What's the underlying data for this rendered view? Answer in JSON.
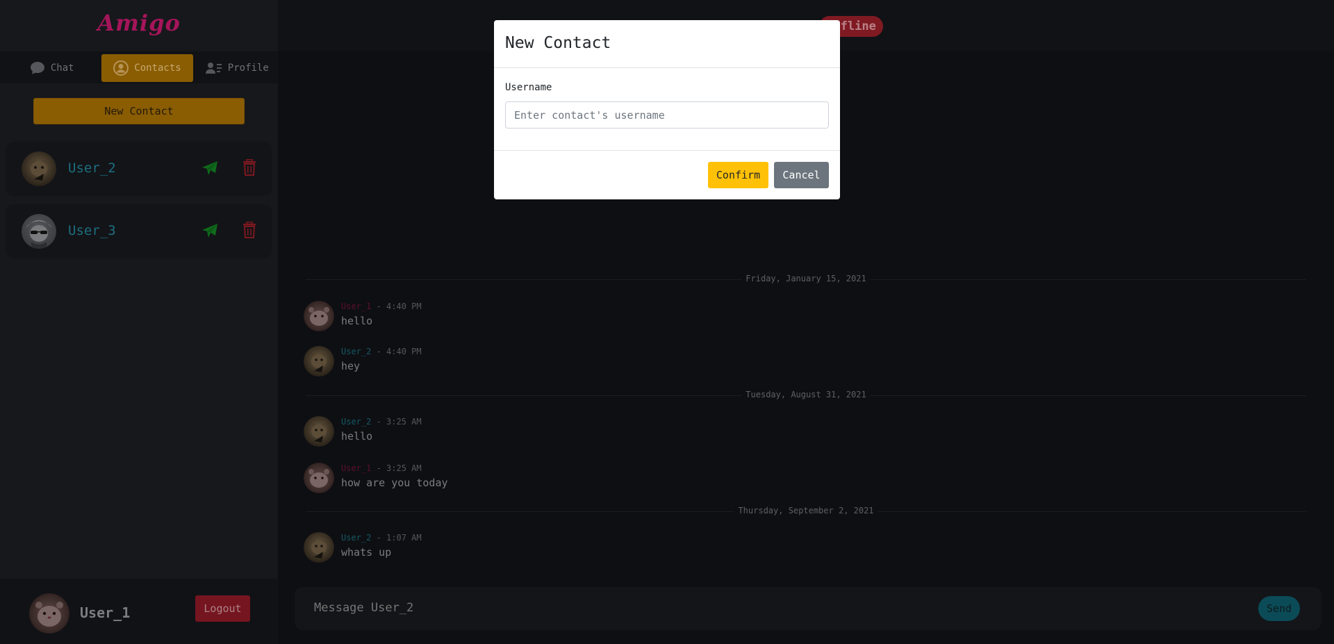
{
  "app": {
    "logo": "Amigo"
  },
  "nav": {
    "chat": "Chat",
    "contacts": "Contacts",
    "profile": "Profile"
  },
  "sidebar": {
    "new_contact_label": "New Contact",
    "contacts": [
      {
        "name": "User_2"
      },
      {
        "name": "User_3"
      }
    ]
  },
  "current_user": {
    "name": "User_1",
    "logout_label": "Logout"
  },
  "chat": {
    "status": "Offline",
    "date_separators": [
      "Friday, January 15, 2021",
      "Tuesday, August 31, 2021",
      "Thursday, September 2, 2021"
    ],
    "messages": [
      {
        "user": "User_1",
        "time": " - 4:40 PM",
        "text": "hello"
      },
      {
        "user": "User_2",
        "time": " - 4:40 PM",
        "text": "hey"
      },
      {
        "user": "User_2",
        "time": " - 3:25 AM",
        "text": "hello"
      },
      {
        "user": "User_1",
        "time": " - 3:25 AM",
        "text": "how are you today"
      },
      {
        "user": "User_2",
        "time": " - 1:07 AM",
        "text": "whats up"
      }
    ],
    "compose_placeholder": "Message User_2",
    "send_label": "Send"
  },
  "modal": {
    "title": "New Contact",
    "field_label": "Username",
    "field_placeholder": "Enter contact's username",
    "field_value": "",
    "confirm_label": "Confirm",
    "cancel_label": "Cancel"
  },
  "colors": {
    "brand": "#a5155a",
    "accent": "#ffc107",
    "danger": "#dc3545",
    "info": "#17a2b8",
    "success": "#198754"
  }
}
